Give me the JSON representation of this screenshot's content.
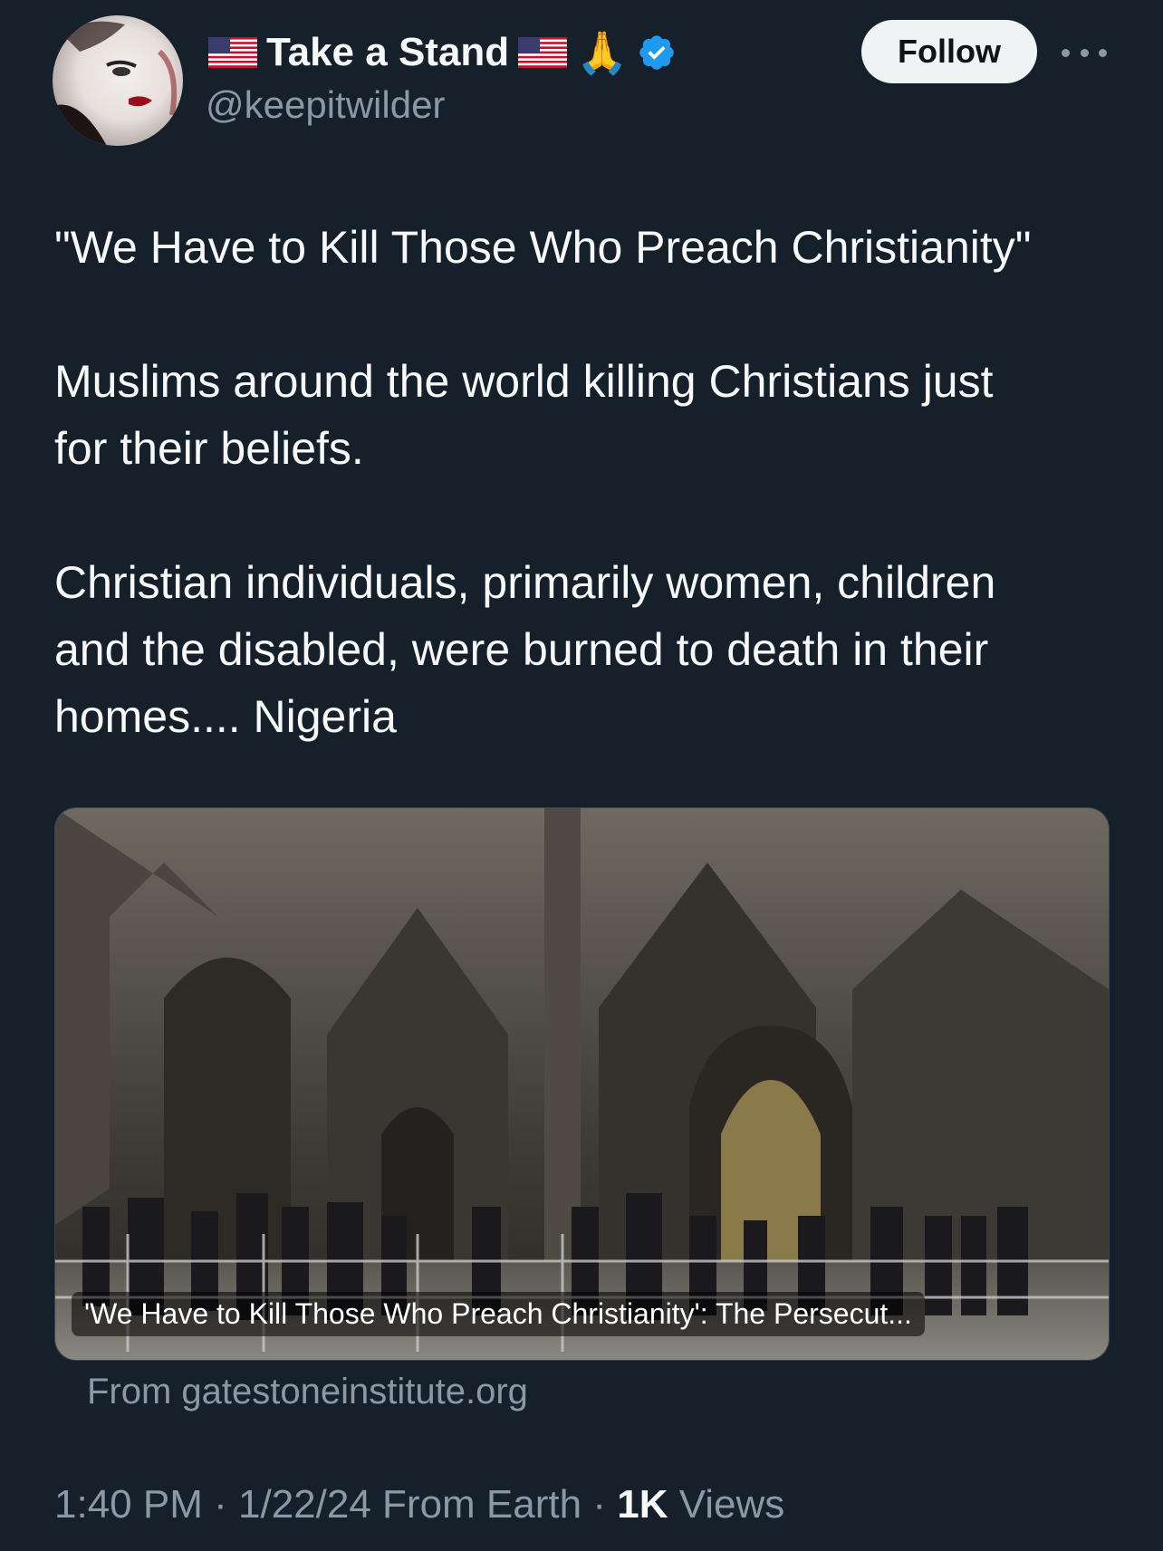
{
  "user": {
    "display_name": "Take a Stand",
    "handle": "@keepitwilder",
    "verified": true,
    "flag_icon": "us-flag-icon",
    "emoji": "🙏"
  },
  "actions": {
    "follow_label": "Follow",
    "more_icon": "more-horizontal-icon"
  },
  "tweet": {
    "lines": [
      "\"We Have to Kill Those Who Preach Christianity\"",
      "Muslims around the world killing Christians just",
      "for their beliefs.",
      "Christian individuals, primarily women, children",
      "and the disabled, were burned to death in their",
      "homes.... Nigeria"
    ]
  },
  "card": {
    "title": "'We Have to Kill Those Who Preach Christianity': The Persecut...",
    "source": "From gatestoneinstitute.org"
  },
  "meta": {
    "time": "1:40 PM",
    "date": "1/22/24",
    "location": "From Earth",
    "views_count": "1K",
    "views_label": "Views",
    "separator": "·"
  },
  "colors": {
    "background": "#15202b",
    "text_primary": "#f7f9f9",
    "text_secondary": "#8b98a5",
    "verified_blue": "#1d9bf0"
  }
}
